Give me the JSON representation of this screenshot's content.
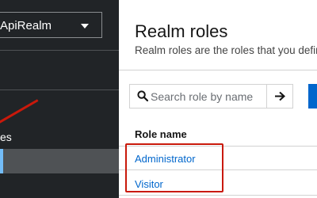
{
  "sidebar": {
    "realm_name": "ApiRealm",
    "partial_item_label": "es"
  },
  "header": {
    "title": "Realm roles",
    "description": "Realm roles are the roles that you defin"
  },
  "toolbar": {
    "search_placeholder": "Search role by name"
  },
  "table": {
    "column_headers": [
      "Role name"
    ],
    "rows": [
      {
        "name": "Administrator"
      },
      {
        "name": "Visitor"
      }
    ]
  },
  "colors": {
    "sidebar_bg": "#212427",
    "link": "#0066cc",
    "annotation": "#c9190b"
  }
}
